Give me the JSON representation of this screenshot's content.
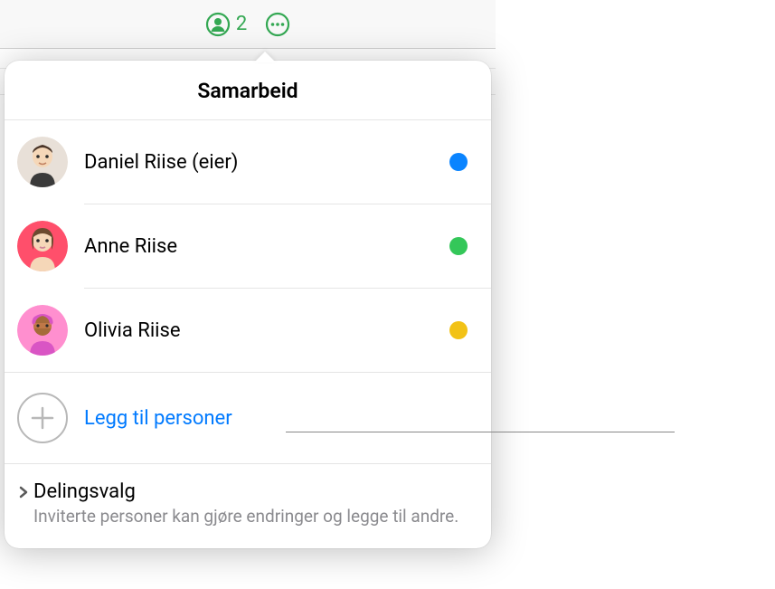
{
  "toolbar": {
    "people_count": "2"
  },
  "popover": {
    "title": "Samarbeid",
    "people": [
      {
        "name": "Daniel Riise (eier)",
        "status_color": "#0a84ff",
        "avatar_bg": "#e8e0d8"
      },
      {
        "name": "Anne Riise",
        "status_color": "#34c759",
        "avatar_bg": "#ff4f6b"
      },
      {
        "name": "Olivia Riise",
        "status_color": "#f2c216",
        "avatar_bg": "#ff8fcf"
      }
    ],
    "add_label": "Legg til personer",
    "sharing": {
      "title": "Delingsvalg",
      "description": "Inviterte personer kan gjøre endringer og legge til andre."
    }
  }
}
